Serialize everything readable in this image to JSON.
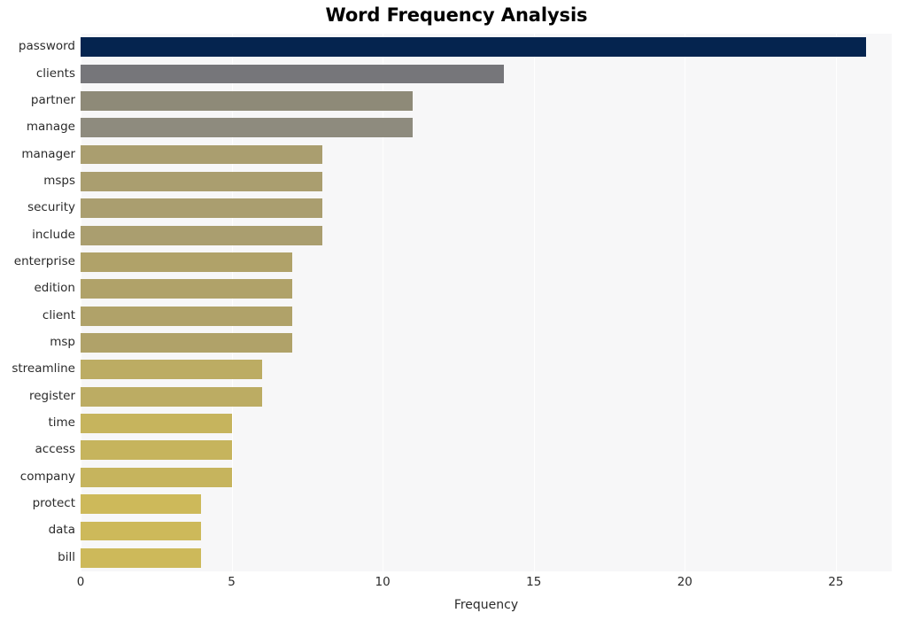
{
  "chart_data": {
    "type": "bar",
    "orientation": "horizontal",
    "title": "Word Frequency Analysis",
    "xlabel": "Frequency",
    "ylabel": "",
    "xlim": [
      0,
      26.85
    ],
    "xticks": [
      0,
      5,
      10,
      15,
      20,
      25
    ],
    "xtick_labels": [
      "0",
      "5",
      "10",
      "15",
      "20",
      "25"
    ],
    "grid": "vertical",
    "legend": "none",
    "categories": [
      "password",
      "clients",
      "partner",
      "manage",
      "manager",
      "msps",
      "security",
      "include",
      "enterprise",
      "edition",
      "client",
      "msp",
      "streamline",
      "register",
      "time",
      "access",
      "company",
      "protect",
      "data",
      "bill"
    ],
    "values": [
      26,
      14,
      11,
      11,
      8,
      8,
      8,
      8,
      7,
      7,
      7,
      7,
      6,
      6,
      5,
      5,
      5,
      4,
      4,
      4
    ],
    "bar_colors": [
      "#05244f",
      "#76767a",
      "#8e8a78",
      "#8e8b7e",
      "#aa9e6f",
      "#aa9e6f",
      "#aa9e6f",
      "#aa9e6f",
      "#b0a269",
      "#b0a269",
      "#b0a269",
      "#b0a269",
      "#bcac63",
      "#bcac63",
      "#c6b45d",
      "#c6b45d",
      "#c6b45d",
      "#cdb95a",
      "#cdb95a",
      "#cdb95a"
    ],
    "plot_background": "#f7f7f8",
    "figure_background": "#ffffff",
    "gridline_color": "#ffffff",
    "text_color": "#2b2b2b",
    "title_color": "#000000"
  }
}
